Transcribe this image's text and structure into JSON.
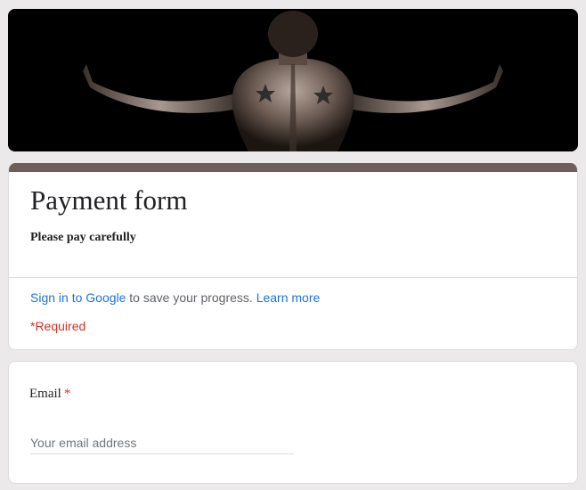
{
  "banner": {
    "alt": ""
  },
  "form": {
    "title": "Payment form",
    "description": "Please pay carefully",
    "accent_color": "#6e5f5b"
  },
  "signin": {
    "link_label": "Sign in to Google",
    "middle_text": " to save your progress. ",
    "learn_more_label": "Learn more"
  },
  "required_note": "*Required",
  "questions": [
    {
      "label": "Email",
      "required_mark": "*",
      "placeholder": "Your email address"
    }
  ],
  "colors": {
    "link": "#1a73e8",
    "required": "#d93025",
    "background": "#ebe9ea"
  }
}
